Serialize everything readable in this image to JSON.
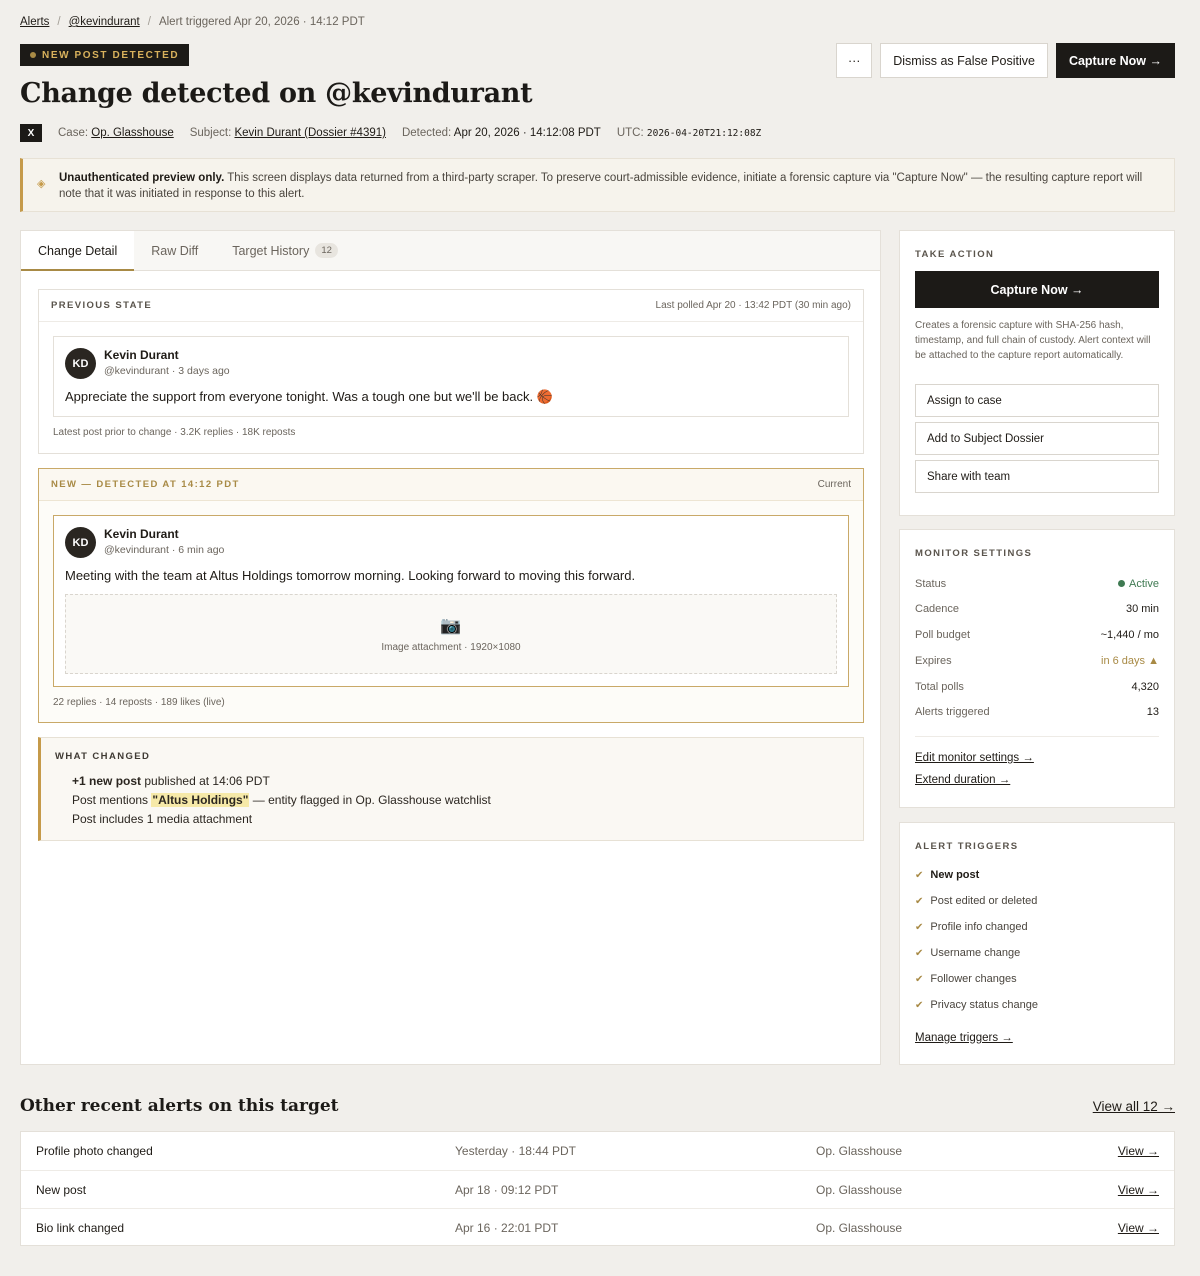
{
  "breadcrumb": {
    "root": "Alerts",
    "target": "@kevindurant",
    "current": "Alert triggered Apr 20, 2026 · 14:12 PDT"
  },
  "badge": {
    "label": "NEW POST DETECTED"
  },
  "title": "Change detected on @kevindurant",
  "actions": {
    "more": "···",
    "dismiss": "Dismiss as False Positive",
    "capture": "Capture Now →"
  },
  "meta": {
    "platform_icon": "X",
    "case_label": "Case:",
    "case_value": "Op. Glasshouse",
    "subject_label": "Subject:",
    "subject_value": "Kevin Durant (Dossier #4391)",
    "detected_label": "Detected:",
    "detected_value": "Apr 20, 2026 · 14:12:08 PDT",
    "utc_label": "UTC:",
    "utc_value": "2026-04-20T21:12:08Z"
  },
  "banner": {
    "strong": "Unauthenticated preview only.",
    "text": " This screen displays data returned from a third-party scraper. To preserve court-admissible evidence, initiate a forensic capture via \"Capture Now\" — the resulting capture report will note that it was initiated in response to this alert."
  },
  "tabs": [
    {
      "label": "Change Detail"
    },
    {
      "label": "Raw Diff"
    },
    {
      "label": "Target History",
      "count": "12"
    }
  ],
  "previous": {
    "caption": "PREVIOUS STATE",
    "polled": "Last polled Apr 20 · 13:42 PDT (30 min ago)",
    "initials": "KD",
    "name": "Kevin Durant",
    "handle": "@kevindurant · 3 days ago",
    "text": "Appreciate the support from everyone tonight. Was a tough one but we'll be back. 🏀",
    "footer": "Latest post prior to change · 3.2K replies · 18K reposts"
  },
  "current": {
    "caption": "NEW — DETECTED AT 14:12 PDT",
    "state": "Current",
    "initials": "KD",
    "name": "Kevin Durant",
    "handle": "@kevindurant · 6 min ago",
    "text": "Meeting with the team at Altus Holdings tomorrow morning. Looking forward to moving this forward.",
    "attachment": "Image attachment · 1920×1080",
    "footer": "22 replies · 14 reposts · 189 likes (live)"
  },
  "changes": {
    "caption": "WHAT CHANGED",
    "line1_strong": "+1 new post",
    "line1_rest": " published at 14:06 PDT",
    "line2_pre": "Post mentions ",
    "line2_hl": "\"Altus Holdings\"",
    "line2_post": " — entity flagged in Op. Glasshouse watchlist",
    "line3": "Post includes 1 media attachment"
  },
  "take_action": {
    "caption": "TAKE ACTION",
    "capture": "Capture Now →",
    "description": "Creates a forensic capture with SHA-256 hash, timestamp, and full chain of custody. Alert context will be attached to the capture report automatically.",
    "assign": "Assign to case",
    "dossier": "Add to Subject Dossier",
    "share": "Share with team"
  },
  "monitor": {
    "caption": "MONITOR SETTINGS",
    "rows": [
      {
        "label": "Status",
        "value": "Active"
      },
      {
        "label": "Cadence",
        "value": "30 min"
      },
      {
        "label": "Poll budget",
        "value": "~1,440 / mo"
      },
      {
        "label": "Expires",
        "value": "in 6 days"
      },
      {
        "label": "Total polls",
        "value": "4,320"
      },
      {
        "label": "Alerts triggered",
        "value": "13"
      }
    ],
    "status_color": "#3f7a52",
    "edit_link": "Edit monitor settings →",
    "extend_link": "Extend duration →"
  },
  "triggers": {
    "caption": "ALERT TRIGGERS",
    "items": [
      "New post",
      "Post edited or deleted",
      "Profile info changed",
      "Username change",
      "Follower changes",
      "Privacy status change"
    ],
    "manage_link": "Manage triggers →"
  },
  "recent": {
    "title": "Other recent alerts on this target",
    "view_all": "View all 12 →",
    "rows": [
      {
        "event": "Profile photo changed",
        "time": "Yesterday · 18:44 PDT",
        "case": "Op. Glasshouse",
        "action": "View →"
      },
      {
        "event": "New post",
        "time": "Apr 18 · 09:12 PDT",
        "case": "Op. Glasshouse",
        "action": "View →"
      },
      {
        "event": "Bio link changed",
        "time": "Apr 16 · 22:01 PDT",
        "case": "Op. Glasshouse",
        "action": "View →"
      }
    ]
  },
  "colors": {
    "accent": "#a88a45",
    "dark": "#1c1a17",
    "background": "#f1efeb",
    "active": "#3f7a52"
  }
}
